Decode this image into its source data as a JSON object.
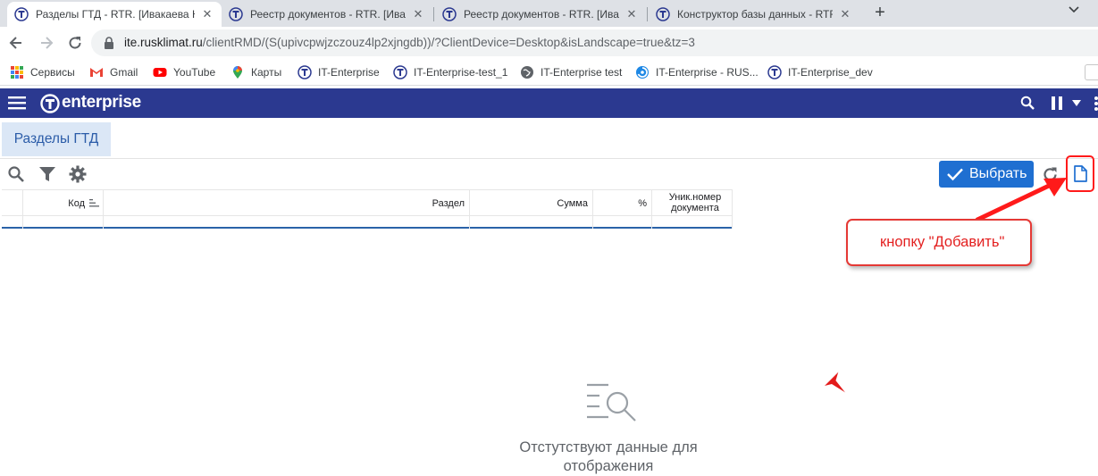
{
  "browser": {
    "tabs": [
      {
        "title": "Разделы ГТД - RTR. [Ивакаева Н",
        "active": true
      },
      {
        "title": "Реестр документов - RTR. [Ивак",
        "active": false
      },
      {
        "title": "Реестр документов - RTR. [Ивак",
        "active": false
      },
      {
        "title": "Конструктор базы данных - RTR",
        "active": false
      }
    ],
    "new_tab": "+",
    "address": {
      "host": "ite.rusklimat.ru",
      "path": "/clientRMD/(S(upivcpwjzczouz4lp2xjngdb))/?ClientDevice=Desktop&isLandscape=true&tz=3"
    },
    "bookmarks": [
      {
        "label": "Сервисы",
        "icon": "apps-grid-icon"
      },
      {
        "label": "Gmail",
        "icon": "gmail-icon"
      },
      {
        "label": "YouTube",
        "icon": "youtube-icon"
      },
      {
        "label": "Карты",
        "icon": "maps-pin-icon"
      },
      {
        "label": "IT-Enterprise",
        "icon": "it-enterprise-icon"
      },
      {
        "label": "IT-Enterprise-test_1",
        "icon": "it-enterprise-icon"
      },
      {
        "label": "IT-Enterprise test",
        "icon": "globe-icon"
      },
      {
        "label": "IT-Enterprise - RUS...",
        "icon": "swirl-icon"
      },
      {
        "label": "IT-Enterprise_dev",
        "icon": "it-enterprise-icon"
      }
    ]
  },
  "app": {
    "logo_text": "enterprise",
    "accent": "#2b3990",
    "page_tab": "Разделы ГТД",
    "select_button": "Выбрать",
    "columns": [
      {
        "label": "Код"
      },
      {
        "label": "Раздел"
      },
      {
        "label": "Сумма"
      },
      {
        "label": "%"
      },
      {
        "label": "Уник.номер документа"
      }
    ],
    "empty_text": "Отстутствуют данные для отображения"
  },
  "annotation": {
    "text": "кнопку \"Добавить\"",
    "color": "#e32020"
  }
}
